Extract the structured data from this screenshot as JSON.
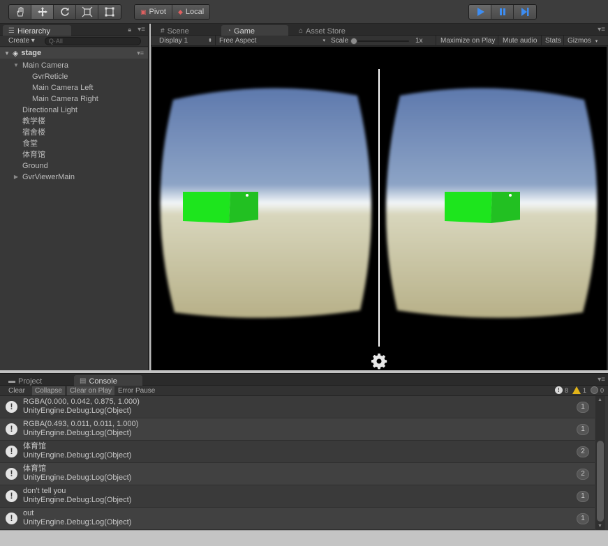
{
  "toolbar": {
    "pivot_label": "Pivot",
    "local_label": "Local",
    "tools": [
      "hand-icon",
      "move-icon",
      "rotate-icon",
      "scale-icon",
      "rect-icon"
    ],
    "play_controls": [
      "play-icon",
      "pause-icon",
      "step-icon"
    ]
  },
  "hierarchy": {
    "tab_label": "Hierarchy",
    "create_label": "Create",
    "search_placeholder": "Q·All",
    "scene_name": "stage",
    "items": [
      {
        "label": "Main Camera",
        "depth": 1,
        "arrow": "expanded"
      },
      {
        "label": "GvrReticle",
        "depth": 2,
        "arrow": "none"
      },
      {
        "label": "Main Camera Left",
        "depth": 2,
        "arrow": "none"
      },
      {
        "label": "Main Camera Right",
        "depth": 2,
        "arrow": "none"
      },
      {
        "label": "Directional Light",
        "depth": 1,
        "arrow": "none"
      },
      {
        "label": "教学楼",
        "depth": 1,
        "arrow": "none"
      },
      {
        "label": "宿舍楼",
        "depth": 1,
        "arrow": "none"
      },
      {
        "label": "食堂",
        "depth": 1,
        "arrow": "none"
      },
      {
        "label": "体育馆",
        "depth": 1,
        "arrow": "none"
      },
      {
        "label": "Ground",
        "depth": 1,
        "arrow": "none"
      },
      {
        "label": "GvrViewerMain",
        "depth": 1,
        "arrow": "collapsed"
      }
    ]
  },
  "game": {
    "tabs": {
      "scene": "Scene",
      "game": "Game",
      "asset_store": "Asset Store"
    },
    "display": "Display 1",
    "aspect": "Free Aspect",
    "scale_label": "Scale",
    "scale_value": "1x",
    "maximize_label": "Maximize on Play",
    "mute_label": "Mute audio",
    "stats_label": "Stats",
    "gizmos_label": "Gizmos",
    "colors": {
      "sky_top": "#6f86b8",
      "sky_horizon": "#eef4f8",
      "ground": "#b8b28a",
      "cube": "#2de82d"
    }
  },
  "console": {
    "tabs": {
      "project": "Project",
      "console": "Console"
    },
    "buttons": {
      "clear": "Clear",
      "collapse": "Collapse",
      "clear_on_play": "Clear on Play",
      "error_pause": "Error Pause"
    },
    "counts": {
      "logs": "8",
      "warnings": "1",
      "errors": "0"
    },
    "entries": [
      {
        "message": "RGBA(0.000, 0.042, 0.875, 1.000)",
        "trace": "UnityEngine.Debug:Log(Object)",
        "count": "1"
      },
      {
        "message": "RGBA(0.493, 0.011, 0.011, 1.000)",
        "trace": "UnityEngine.Debug:Log(Object)",
        "count": "1"
      },
      {
        "message": "体育馆",
        "trace": "UnityEngine.Debug:Log(Object)",
        "count": "2"
      },
      {
        "message": "体育馆",
        "trace": "UnityEngine.Debug:Log(Object)",
        "count": "2"
      },
      {
        "message": "don't tell you",
        "trace": "UnityEngine.Debug:Log(Object)",
        "count": "1"
      },
      {
        "message": "out",
        "trace": "UnityEngine.Debug:Log(Object)",
        "count": "1"
      }
    ]
  }
}
